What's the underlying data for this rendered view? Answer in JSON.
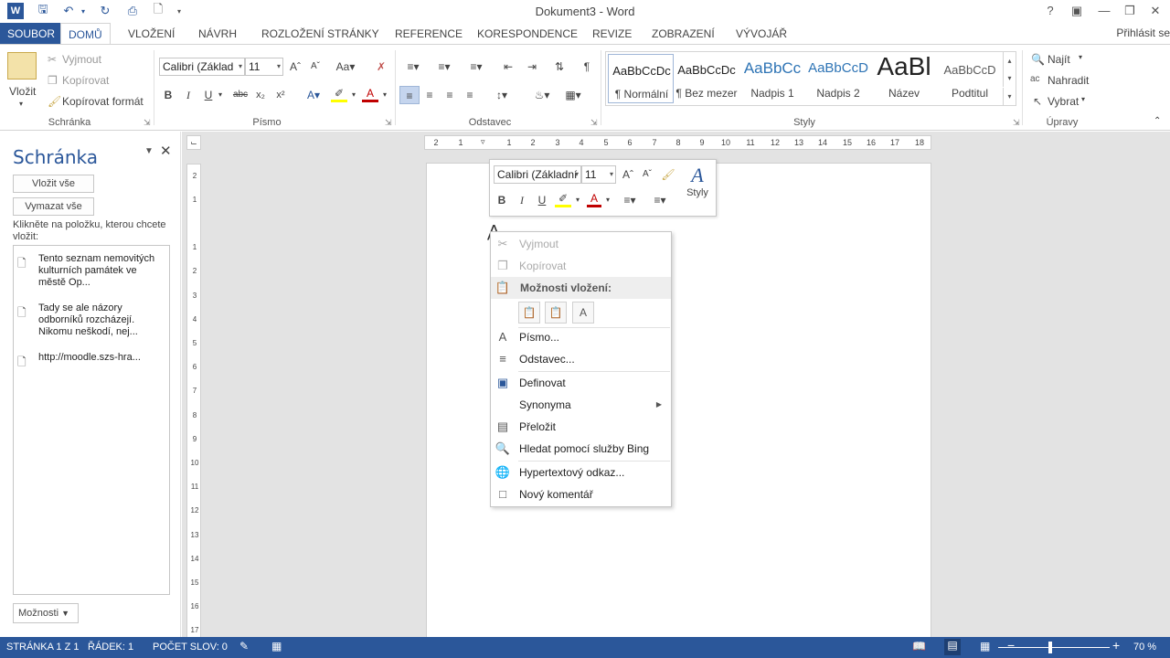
{
  "window": {
    "title": "Dokument3 - Word",
    "help": "?",
    "sign_in": "Přihlásit se"
  },
  "tabs": [
    {
      "label": "SOUBOR"
    },
    {
      "label": "DOMŮ"
    },
    {
      "label": "VLOŽENÍ"
    },
    {
      "label": "NÁVRH"
    },
    {
      "label": "ROZLOŽENÍ STRÁNKY"
    },
    {
      "label": "REFERENCE"
    },
    {
      "label": "KORESPONDENCE"
    },
    {
      "label": "REVIZE"
    },
    {
      "label": "ZOBRAZENÍ"
    },
    {
      "label": "VÝVOJÁŘ"
    }
  ],
  "ribbon": {
    "clipboard": {
      "paste": "Vložit",
      "cut": "Vyjmout",
      "copy": "Kopírovat",
      "format_painter": "Kopírovat formát",
      "label": "Schránka"
    },
    "font": {
      "font_name": "Calibri (Základ",
      "font_size": "11",
      "bold": "B",
      "italic": "I",
      "underline": "U",
      "strike": "abc",
      "label": "Písmo"
    },
    "paragraph": {
      "label": "Odstavec"
    },
    "styles": {
      "label": "Styly",
      "items": [
        {
          "preview": "AaBbCcDc",
          "name": "¶ Normální"
        },
        {
          "preview": "AaBbCcDc",
          "name": "¶ Bez mezer"
        },
        {
          "preview": "AaBbCc",
          "name": "Nadpis 1"
        },
        {
          "preview": "AaBbCcD",
          "name": "Nadpis 2"
        },
        {
          "preview": "AaBl",
          "name": "Název"
        },
        {
          "preview": "AaBbCcD",
          "name": "Podtitul"
        }
      ]
    },
    "editing": {
      "find": "Najít",
      "replace": "Nahradit",
      "select": "Vybrat",
      "label": "Úpravy"
    }
  },
  "clipboard_pane": {
    "title": "Schránka",
    "paste_all": "Vložit vše",
    "clear_all": "Vymazat vše",
    "hint": "Klikněte na položku, kterou chcete vložit:",
    "items": [
      {
        "text": "Tento seznam nemovitých kulturních památek ve městě Op..."
      },
      {
        "text": "Tady se ale názory odborníků rozcházejí. Nikomu neškodí, nej..."
      },
      {
        "text": "http://moodle.szs-hra..."
      }
    ],
    "options": "Možnosti"
  },
  "ruler": {
    "h_ticks": [
      "2",
      "1",
      "1",
      "2",
      "3",
      "4",
      "5",
      "6",
      "7",
      "8",
      "9",
      "10",
      "11",
      "12",
      "13",
      "14",
      "15",
      "16",
      "17",
      "18"
    ],
    "v_ticks": [
      "2",
      "1",
      "1",
      "2",
      "3",
      "4",
      "5",
      "6",
      "7",
      "8",
      "9",
      "10",
      "11",
      "12",
      "13",
      "14",
      "15",
      "16",
      "17"
    ]
  },
  "mini_toolbar": {
    "font_name": "Calibri (Základní",
    "font_size": "11",
    "styles_label": "Styly"
  },
  "context_menu": {
    "items": [
      {
        "label": "Vyjmout",
        "icon": "cut-icon",
        "disabled": true
      },
      {
        "label": "Kopírovat",
        "icon": "copy-icon",
        "disabled": true
      },
      {
        "label": "Písmo...",
        "icon": "font-icon",
        "disabled": false
      },
      {
        "label": "Odstavec...",
        "icon": "paragraph-icon",
        "disabled": false
      },
      {
        "label": "Definovat",
        "icon": "define-icon",
        "disabled": false
      },
      {
        "label": "Synonyma",
        "icon": "synonyms-icon",
        "disabled": false
      },
      {
        "label": "Přeložit",
        "icon": "translate-icon",
        "disabled": false
      },
      {
        "label": "Hledat pomocí služby Bing",
        "icon": "search-icon",
        "disabled": false
      },
      {
        "label": "Hypertextový odkaz...",
        "icon": "link-icon",
        "disabled": false
      },
      {
        "label": "Nový komentář",
        "icon": "comment-icon",
        "disabled": false
      }
    ],
    "paste_header": "Možnosti vložení:"
  },
  "status_bar": {
    "page": "STRÁNKA 1 Z 1",
    "line": "ŘÁDEK: 1",
    "words": "POČET SLOV: 0",
    "zoom": "70 %"
  },
  "colors": {
    "accent": "#2b579a",
    "highlight": "#ffff00",
    "font_color": "#c00000"
  }
}
